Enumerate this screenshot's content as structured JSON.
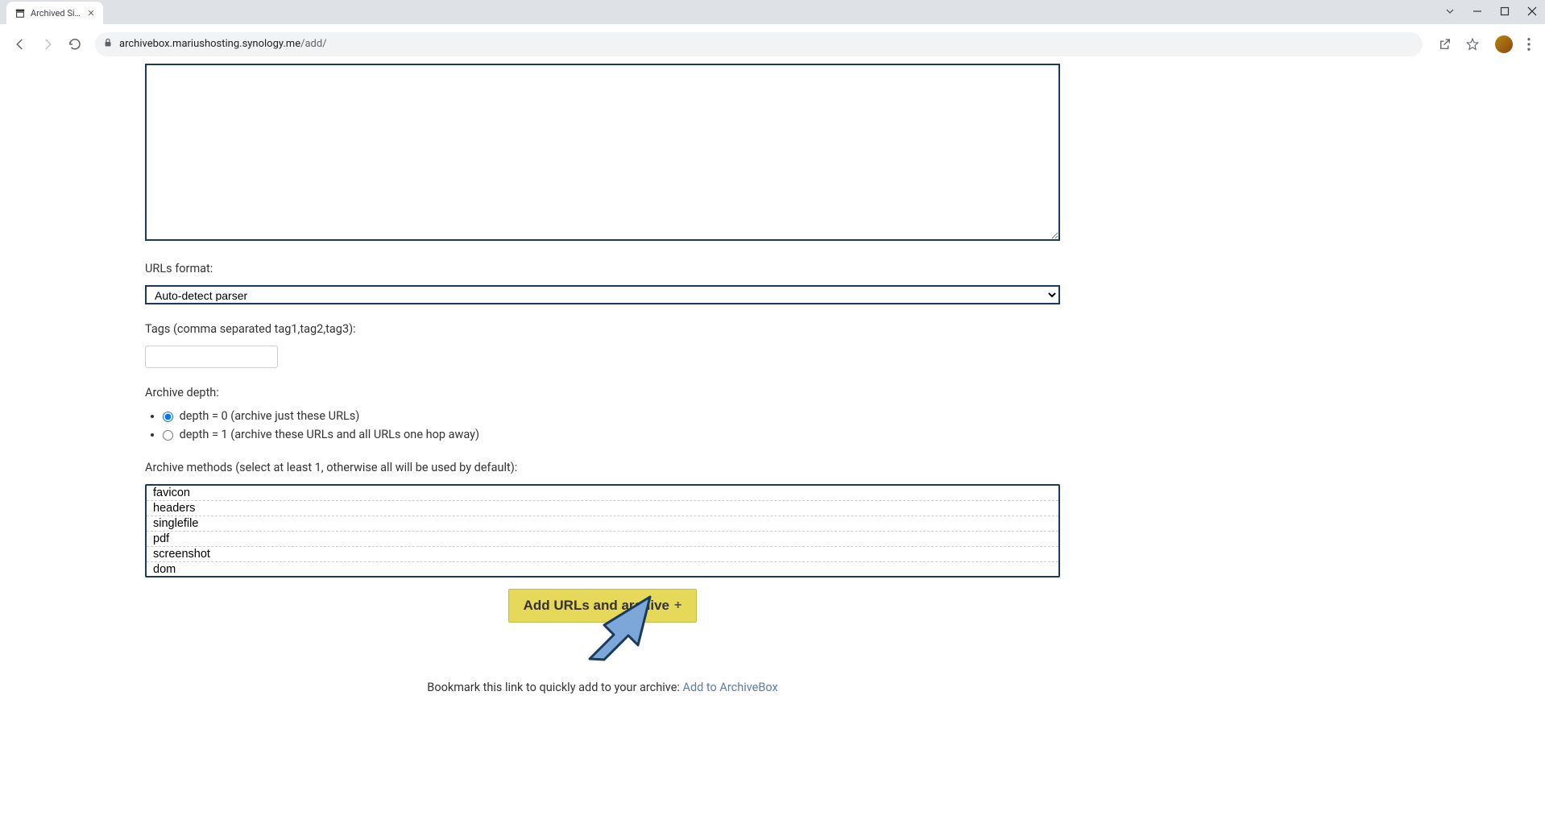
{
  "browser": {
    "tab_title": "Archived Sites",
    "url_host": "archivebox.mariushosting.synology.me",
    "url_path": "/add/"
  },
  "form": {
    "urls_format_label": "URLs format:",
    "urls_format_value": "Auto-detect parser",
    "tags_label": "Tags (comma separated tag1,tag2,tag3):",
    "tags_value": "",
    "archive_depth_label": "Archive depth:",
    "depth_options": [
      {
        "label": "depth = 0 (archive just these URLs)",
        "checked": true
      },
      {
        "label": "depth = 1 (archive these URLs and all URLs one hop away)",
        "checked": false
      }
    ],
    "methods_label": "Archive methods (select at least 1, otherwise all will be used by default):",
    "methods": [
      "favicon",
      "headers",
      "singlefile",
      "pdf",
      "screenshot",
      "dom"
    ],
    "submit_label": "Add URLs and archive",
    "bookmark_text": "Bookmark this link to quickly add to your archive: ",
    "bookmark_link": "Add to ArchiveBox"
  }
}
